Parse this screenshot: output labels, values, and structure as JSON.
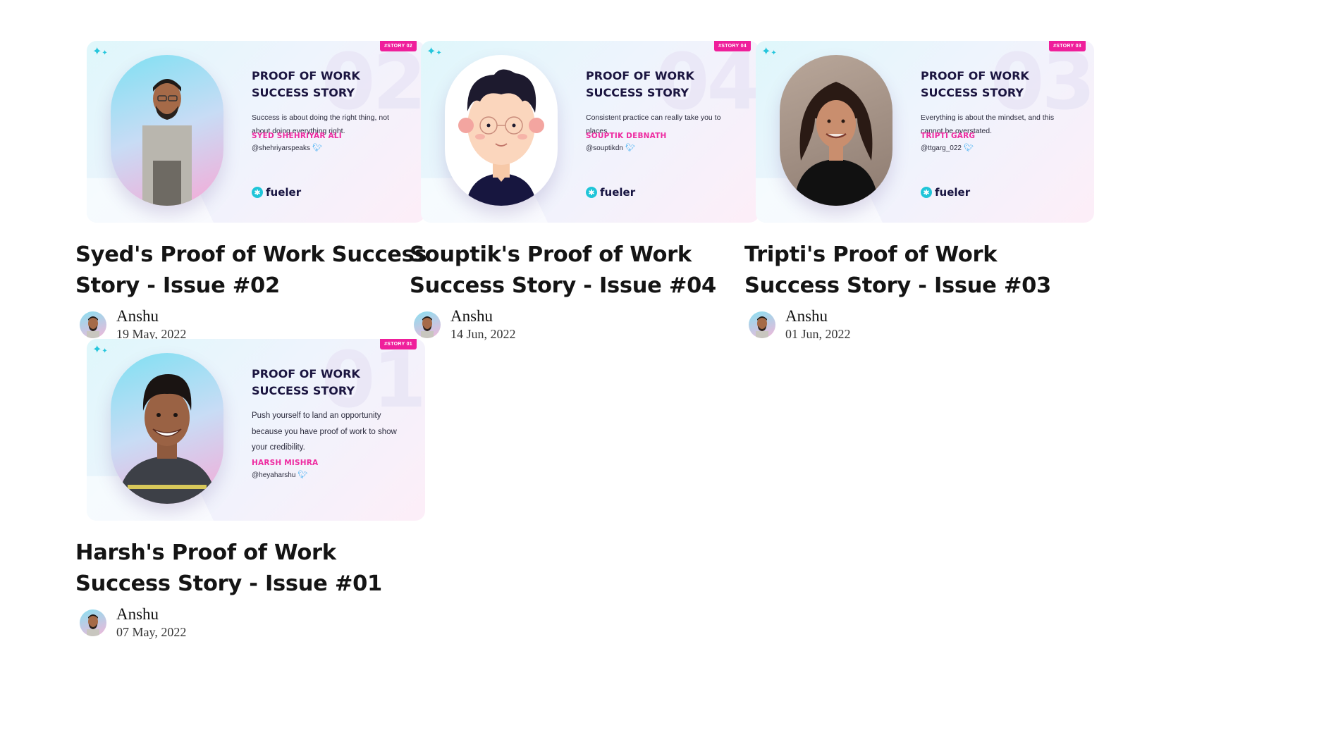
{
  "posts": [
    {
      "title": "Syed's Proof of Work Success Story - Issue #02",
      "author": "Anshu",
      "date": "19 May, 2022",
      "banner": {
        "bg_number": "02",
        "story_tag": "#STORY 02",
        "headline_1": "PROOF OF WORK",
        "headline_2": "SUCCESS STORY",
        "quote": "Success is about doing the right thing, not about doing everything right.",
        "person_name": "SYED SHEHRIYAR ALI",
        "handle": "@shehriyarspeaks",
        "brand": "fueler"
      }
    },
    {
      "title": "Souptik's Proof of Work Success Story - Issue #04",
      "author": "Anshu",
      "date": "14 Jun, 2022",
      "banner": {
        "bg_number": "04",
        "story_tag": "#STORY 04",
        "headline_1": "PROOF OF WORK",
        "headline_2": "SUCCESS STORY",
        "quote": "Consistent practice can really take you to places",
        "person_name": "SOUPTIK DEBNATH",
        "handle": "@souptikdn",
        "brand": "fueler"
      }
    },
    {
      "title": "Tripti's Proof of Work Success Story - Issue #03",
      "author": "Anshu",
      "date": "01 Jun, 2022",
      "banner": {
        "bg_number": "03",
        "story_tag": "#STORY 03",
        "headline_1": "PROOF OF WORK",
        "headline_2": "SUCCESS STORY",
        "quote": "Everything is about the mindset, and this cannot be overstated.",
        "person_name": "TRIPTI GARG",
        "handle": "@ttgarg_022",
        "brand": "fueler"
      }
    },
    {
      "title": "Harsh's Proof of Work Success Story - Issue #01",
      "author": "Anshu",
      "date": "07 May, 2022",
      "banner": {
        "bg_number": "01",
        "story_tag": "#STORY 01",
        "headline_1": "PROOF OF WORK",
        "headline_2": "SUCCESS STORY",
        "quote": "Push yourself to land an opportunity because you have proof of work to show your credibility.",
        "person_name": "HARSH MISHRA",
        "handle": "@heyaharshu"
      }
    }
  ],
  "icons": {
    "sparkle": "sparkle-icon",
    "twitter": "twitter-bird-icon",
    "brand_logo": "fueler-logo-icon"
  },
  "colors": {
    "accent_pink": "#ef1f9b",
    "accent_cyan": "#20c5d8",
    "headline": "#1b1540"
  }
}
